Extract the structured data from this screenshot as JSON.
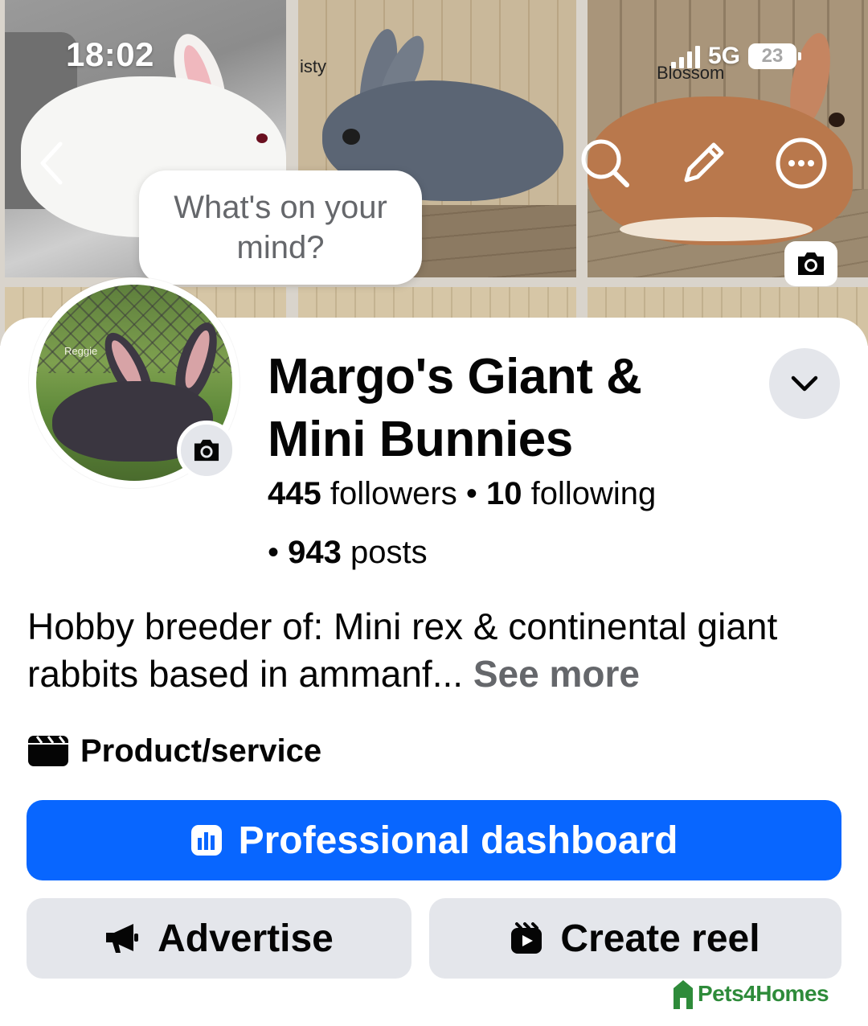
{
  "status_bar": {
    "time": "18:02",
    "network": "5G",
    "battery": "23"
  },
  "cover": {
    "tile_labels": [
      "isty",
      "Blossom"
    ]
  },
  "avatar": {
    "tag": "Reggie"
  },
  "composer": {
    "prompt": "What's on your mind?"
  },
  "profile": {
    "name": "Margo's Giant & Mini Bunnies",
    "followers_count": "445",
    "followers_label": "followers",
    "following_count": "10",
    "following_label": "following",
    "posts_count": "943",
    "posts_label": "posts",
    "separator": "•",
    "bio": "Hobby breeder of: Mini rex & continental giant rabbits based in ammanf...",
    "see_more": "See more",
    "category": "Product/service"
  },
  "actions": {
    "dashboard_label": "Professional dashboard",
    "advertise_label": "Advertise",
    "create_reel_label": "Create reel"
  },
  "watermark": {
    "text": "Pets4Homes"
  },
  "icons": {
    "back": "chevron-left-icon",
    "search": "search-icon",
    "edit": "pencil-icon",
    "more": "more-dots-icon",
    "cover_camera": "camera-icon",
    "avatar_camera": "camera-icon",
    "dropdown": "chevron-down-icon",
    "category": "clapperboard-icon",
    "dashboard": "chart-bars-icon",
    "advertise": "megaphone-icon",
    "reel": "reel-icon"
  },
  "colors": {
    "primary": "#0866ff",
    "secondary_bg": "#e4e6eb",
    "muted_text": "#65676b",
    "watermark": "#2e8b3a"
  }
}
